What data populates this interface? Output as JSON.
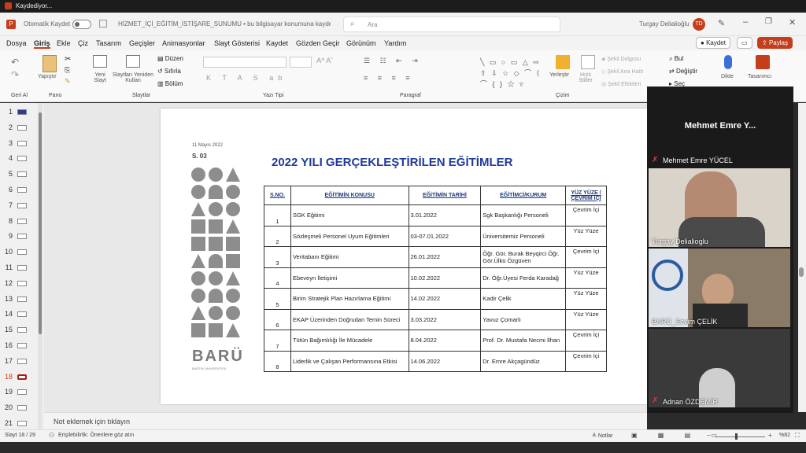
{
  "window": {
    "top_strip": "Kaydediyor...",
    "autosave": "Otomatik Kaydet",
    "filename": "HİZMET_İÇİ_EĞİTİM_İSTİŞARE_SUNUMU • bu bilgisayar konumuna kaydedildi",
    "search_placeholder": "Ara",
    "user": "Turgay Delialioğlu",
    "user_initials": "TD"
  },
  "menu": [
    "Dosya",
    "Giriş",
    "Ekle",
    "Çiz",
    "Tasarım",
    "Geçişler",
    "Animasyonlar",
    "Slayt Gösterisi",
    "Kaydet",
    "Gözden Geçir",
    "Görünüm",
    "Yardım"
  ],
  "actions": {
    "save": "Kaydet",
    "share": "Paylaş"
  },
  "ribbon": {
    "paste": "Yapıştır",
    "new_slide": "Yeni Slayt",
    "reuse_slides": "Slaytları Yeniden Kullan",
    "layout": "Düzen",
    "reset": "Sıfırla",
    "section": "Bölüm",
    "quick_styles": "Hızlı Stiller",
    "arrange": "Yerleştir",
    "shape_fill": "Şekil Dolgusu",
    "shape_outline": "Şekil Ana Hattı",
    "shape_effects": "Şekil Efektleri",
    "find": "Bul",
    "replace": "Değiştir",
    "select": "Seç",
    "dictate": "Dikte",
    "designer": "Tasarımcı",
    "groups": {
      "undo": "Geri Al",
      "clipboard": "Pano",
      "slides": "Slaytlar",
      "font": "Yazı Tipi",
      "paragraph": "Paragraf",
      "drawing": "Çizim"
    }
  },
  "slides": {
    "numbers": [
      "1",
      "2",
      "3",
      "4",
      "5",
      "6",
      "7",
      "8",
      "9",
      "10",
      "11",
      "12",
      "13",
      "14",
      "15",
      "16",
      "17",
      "18",
      "19",
      "20",
      "21"
    ],
    "current": "18"
  },
  "slide": {
    "date": "11 Mayıs 2022",
    "page": "S. 03",
    "brand": "BARÜ",
    "brand_sub": "BARTIN ÜNİVERSİTESİ",
    "title": "2022 YILI GERÇEKLEŞTİRİLEN EĞİTİMLER",
    "headers": [
      "S.NO.",
      "EĞİTİMİN KONUSU",
      "EĞİTİMİN TARİHİ",
      "EĞİTİMCİ/KURUM",
      "YÜZ YÜZE / ÇEVRİM İÇİ"
    ],
    "rows": [
      [
        "1",
        "SGK Eğitimi",
        "3.01.2022",
        "Sgk Başkanlığı Personeli",
        "Çevrim İçi"
      ],
      [
        "2",
        "Sözleşmeli Personel Uyum Eğitimleri",
        "03-07.01.2022",
        "Üniversitemiz Personeli",
        "Yüz Yüze"
      ],
      [
        "3",
        "Veritabanı Eğitimi",
        "26.01.2022",
        "Öğr. Gör. Burak Beyqirci Öğr. Gör.Ülkü Özgüven",
        "Çevrim İçi"
      ],
      [
        "4",
        "Ebeveyn İletişimi",
        "10.02.2022",
        "Dr. Öğr.Üyesi Ferda Karadağ",
        "Yüz Yüze"
      ],
      [
        "5",
        "Birim Stratejik Plan Hazırlama Eğitimi",
        "14.02.2022",
        "Kadir Çelik",
        "Yüz Yüze"
      ],
      [
        "6",
        "EKAP Üzerinden Doğrudan Temin Süreci",
        "3.03.2022",
        "Yavuz Çomarlı",
        "Yüz Yüze"
      ],
      [
        "7",
        "Tütün Bağımlılığı İle Mücadele",
        "8.04.2022",
        "Prof. Dr. Mustafa Necmi İlhan",
        "Çevrim İçi"
      ],
      [
        "8",
        "Liderlik ve Çalışan Performansına Etkisi",
        "14.06.2022",
        "Dr. Emre Akçagündüz",
        "Çevrim İçi"
      ]
    ]
  },
  "notes_placeholder": "Not eklemek için tıklayın",
  "status": {
    "slide_counter": "Slayt 18 / 29",
    "accessibility": "Erişilebilirlik: Önerilere göz atın",
    "notes": "Notlar",
    "zoom": "%82"
  },
  "meeting": {
    "header_name": "Mehmet Emre Y...",
    "participants": [
      "Mehmet Emre YÜCEL",
      "Turgay Delialioglu",
      "BARÜ_Sevim ÇELİK",
      "Adnan ÖZDEMİR"
    ]
  },
  "colors": {
    "accent": "#c43e1c",
    "title_blue": "#1f3a9a"
  }
}
